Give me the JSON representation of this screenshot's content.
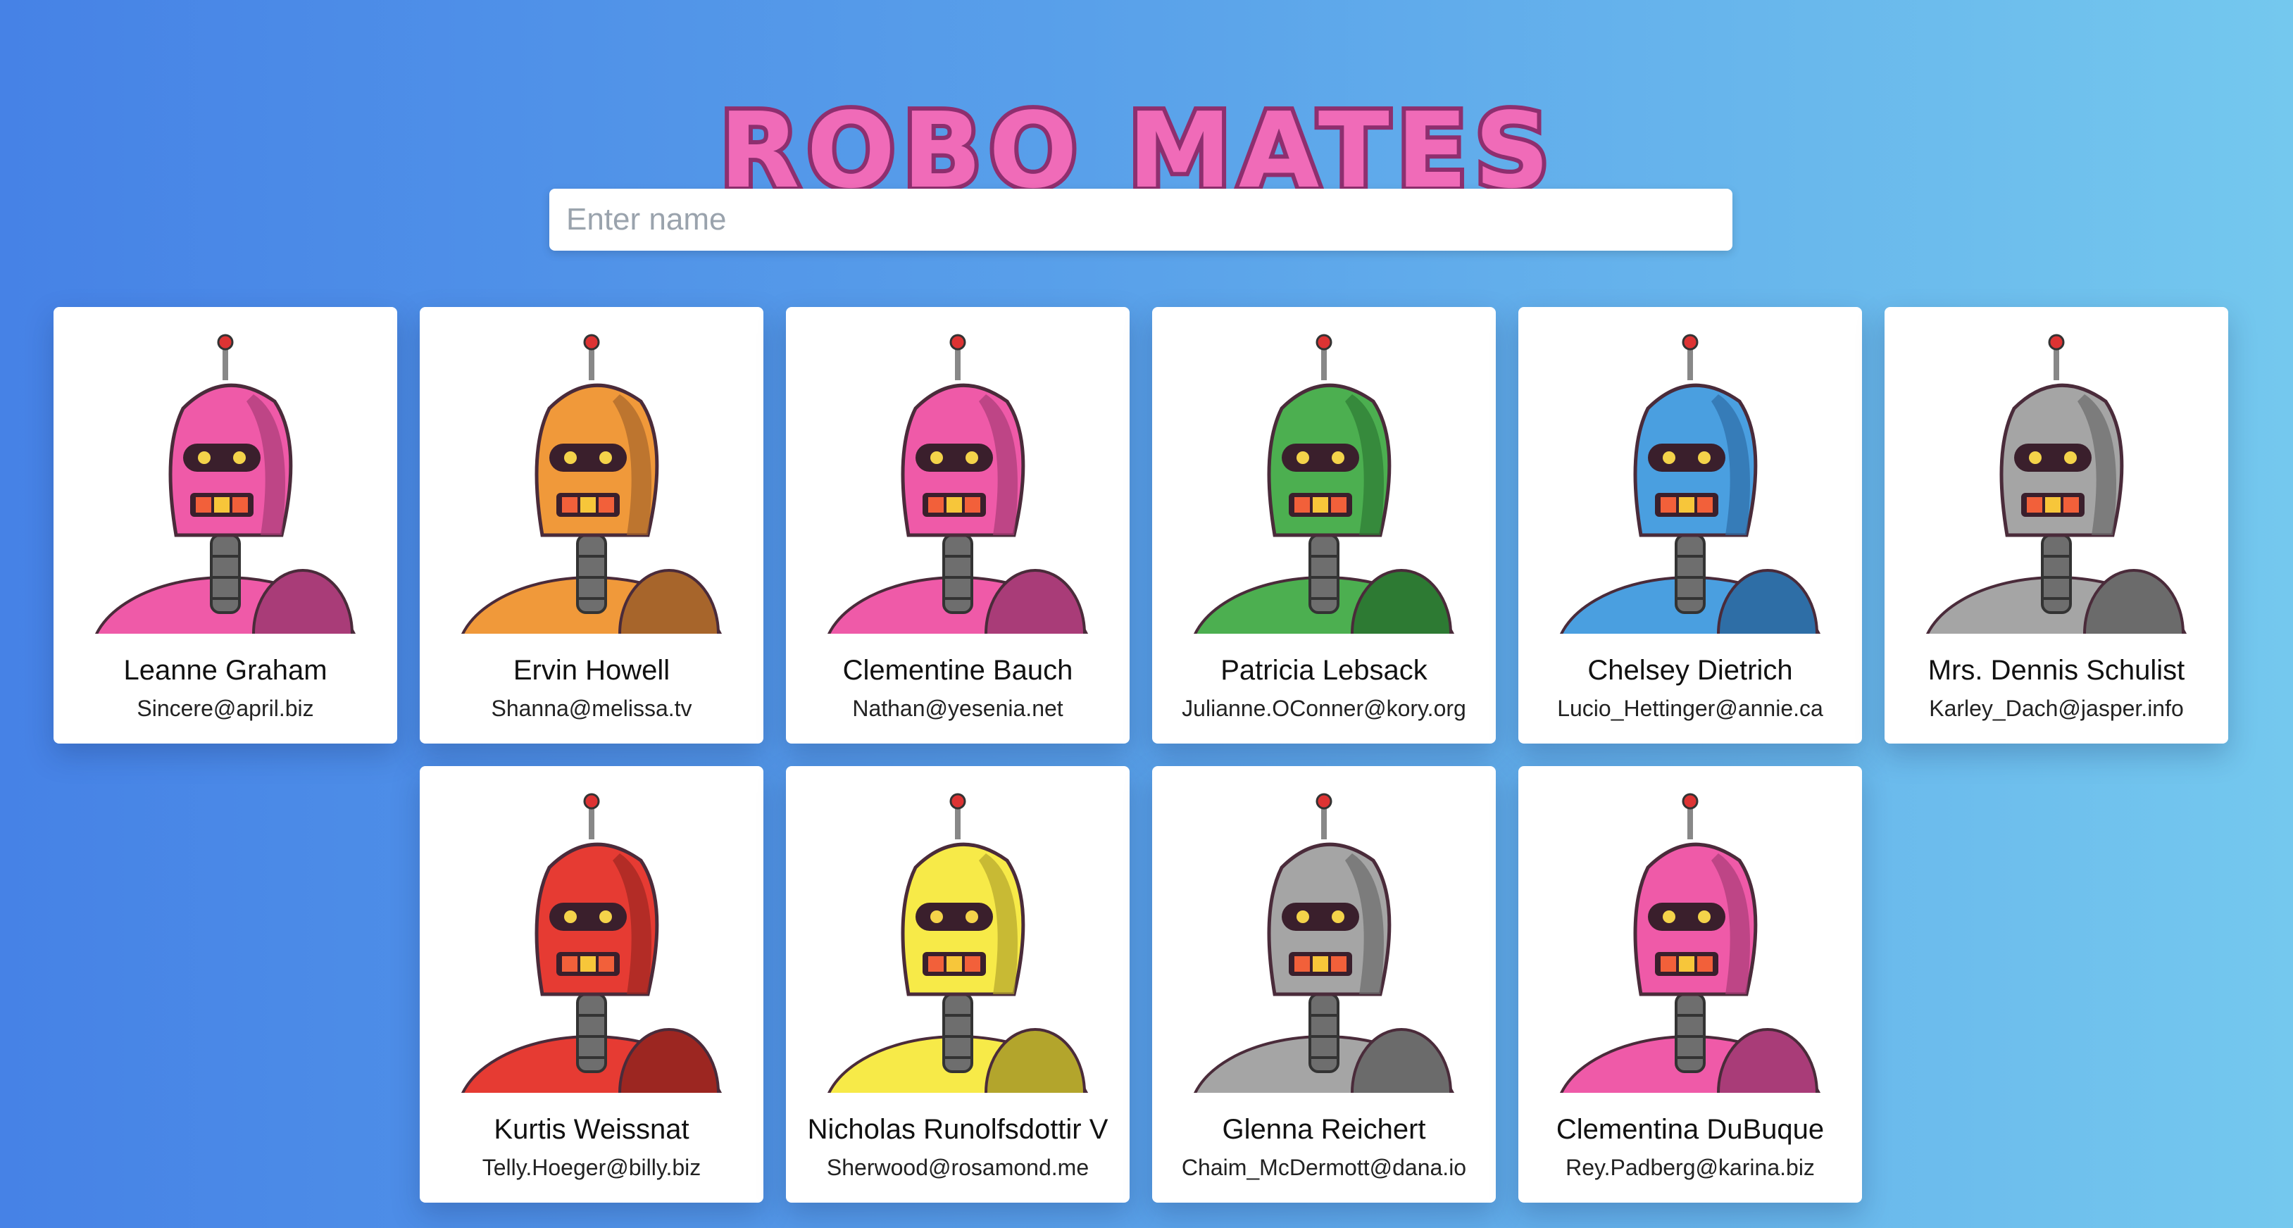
{
  "header": {
    "title": "ROBO MATES"
  },
  "search": {
    "placeholder": "Enter name",
    "value": ""
  },
  "robots": [
    {
      "name": "Leanne Graham",
      "email": "Sincere@april.biz",
      "color": "#ef5aa8",
      "dark": "#a93c78",
      "icon": "robot-avatar"
    },
    {
      "name": "Ervin Howell",
      "email": "Shanna@melissa.tv",
      "color": "#f0993a",
      "dark": "#a7652b",
      "icon": "robot-avatar"
    },
    {
      "name": "Clementine Bauch",
      "email": "Nathan@yesenia.net",
      "color": "#ef5aa8",
      "dark": "#a93c78",
      "icon": "robot-avatar"
    },
    {
      "name": "Patricia Lebsack",
      "email": "Julianne.OConner@kory.org",
      "color": "#4caf50",
      "dark": "#2d7a33",
      "icon": "robot-avatar"
    },
    {
      "name": "Chelsey Dietrich",
      "email": "Lucio_Hettinger@annie.ca",
      "color": "#4a9fe0",
      "dark": "#2e6ea6",
      "icon": "robot-avatar"
    },
    {
      "name": "Mrs. Dennis Schulist",
      "email": "Karley_Dach@jasper.info",
      "color": "#a5a5a5",
      "dark": "#6b6b6b",
      "icon": "robot-avatar"
    },
    {
      "name": "Kurtis Weissnat",
      "email": "Telly.Hoeger@billy.biz",
      "color": "#e63b33",
      "dark": "#9c2621",
      "icon": "robot-avatar"
    },
    {
      "name": "Nicholas Runolfsdottir V",
      "email": "Sherwood@rosamond.me",
      "color": "#f7ea48",
      "dark": "#b3a52c",
      "icon": "robot-avatar"
    },
    {
      "name": "Glenna Reichert",
      "email": "Chaim_McDermott@dana.io",
      "color": "#a5a5a5",
      "dark": "#6b6b6b",
      "icon": "robot-avatar"
    },
    {
      "name": "Clementina DuBuque",
      "email": "Rey.Padberg@karina.biz",
      "color": "#ef5aa8",
      "dark": "#a93c78",
      "icon": "robot-avatar"
    }
  ]
}
